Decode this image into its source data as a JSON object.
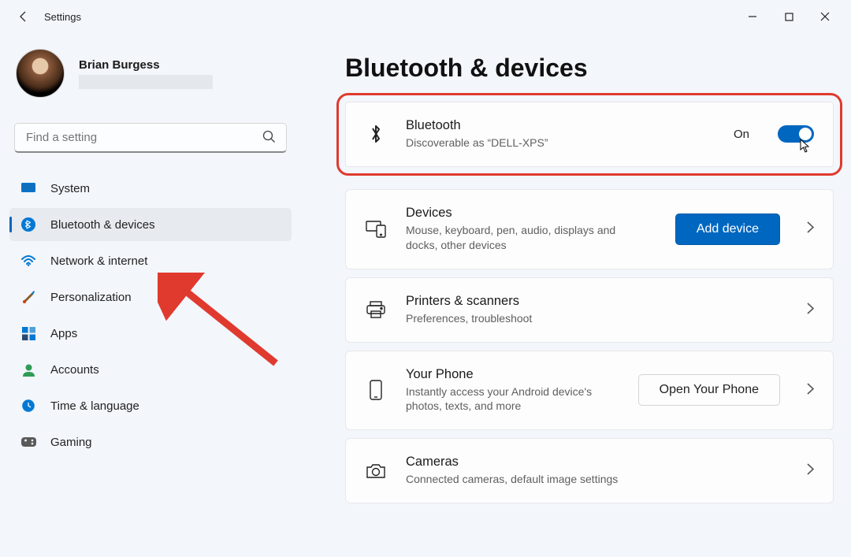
{
  "app": {
    "title": "Settings"
  },
  "account": {
    "name": "Brian Burgess"
  },
  "search": {
    "placeholder": "Find a setting"
  },
  "nav": {
    "items": [
      {
        "label": "System"
      },
      {
        "label": "Bluetooth & devices"
      },
      {
        "label": "Network & internet"
      },
      {
        "label": "Personalization"
      },
      {
        "label": "Apps"
      },
      {
        "label": "Accounts"
      },
      {
        "label": "Time & language"
      },
      {
        "label": "Gaming"
      }
    ],
    "selected_index": 1
  },
  "page": {
    "title": "Bluetooth & devices"
  },
  "cards": {
    "bluetooth": {
      "title": "Bluetooth",
      "subtitle": "Discoverable as “DELL-XPS”",
      "toggle_label": "On",
      "toggle_state": true
    },
    "devices": {
      "title": "Devices",
      "subtitle": "Mouse, keyboard, pen, audio, displays and docks, other devices",
      "button": "Add device"
    },
    "printers": {
      "title": "Printers & scanners",
      "subtitle": "Preferences, troubleshoot"
    },
    "phone": {
      "title": "Your Phone",
      "subtitle": "Instantly access your Android device's photos, texts, and more",
      "button": "Open Your Phone"
    },
    "cameras": {
      "title": "Cameras",
      "subtitle": "Connected cameras, default image settings"
    }
  }
}
